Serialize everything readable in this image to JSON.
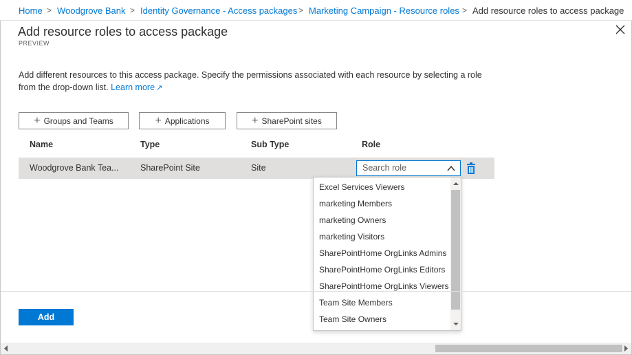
{
  "breadcrumb": {
    "items": [
      "Home",
      "Woodgrove Bank",
      "Identity Governance - Access packages",
      "Marketing Campaign - Resource roles"
    ],
    "current": "Add resource roles to access package",
    "separator": ">"
  },
  "panel": {
    "title": "Add resource roles to access package",
    "badge": "PREVIEW",
    "close_icon": "close-icon"
  },
  "description": {
    "text": "Add different resources to this access package. Specify the permissions associated with each resource by selecting a role from the drop-down list.",
    "link": "Learn more",
    "link_icon": "↗"
  },
  "toolbar": {
    "buttons": [
      "Groups and Teams",
      "Applications",
      "SharePoint sites"
    ],
    "plus": "+"
  },
  "table": {
    "headers": [
      "Name",
      "Type",
      "Sub Type",
      "Role"
    ],
    "rows": [
      {
        "name": "Woodgrove Bank Tea...",
        "type": "SharePoint Site",
        "subtype": "Site"
      }
    ]
  },
  "role_search": {
    "placeholder": "Search role",
    "options": [
      "Excel Services Viewers",
      "marketing Members",
      "marketing Owners",
      "marketing Visitors",
      "SharePointHome OrgLinks Admins",
      "SharePointHome OrgLinks Editors",
      "SharePointHome OrgLinks Viewers",
      "Team Site Members",
      "Team Site Owners"
    ]
  },
  "footer": {
    "add_label": "Add"
  },
  "colors": {
    "accent": "#0078d4",
    "row_highlight": "#e1dfdd",
    "text": "#323130"
  }
}
